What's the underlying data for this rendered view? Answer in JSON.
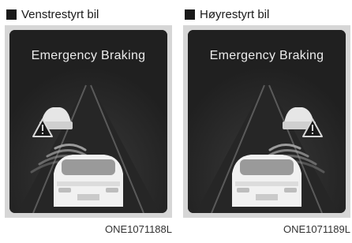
{
  "left_panel": {
    "heading": "Venstrestyrt bil",
    "screen_title": "Emergency Braking",
    "code": "ONE1071188L"
  },
  "right_panel": {
    "heading": "Høyrestyrt bil",
    "screen_title": "Emergency Braking",
    "code": "ONE1071189L"
  },
  "icons": [
    "warning-triangle-icon",
    "vehicle-ahead-icon",
    "car-icon"
  ],
  "colors": {
    "screen": "#2b2b2b",
    "frame": "#d6d6d6",
    "text": "#ececec"
  }
}
